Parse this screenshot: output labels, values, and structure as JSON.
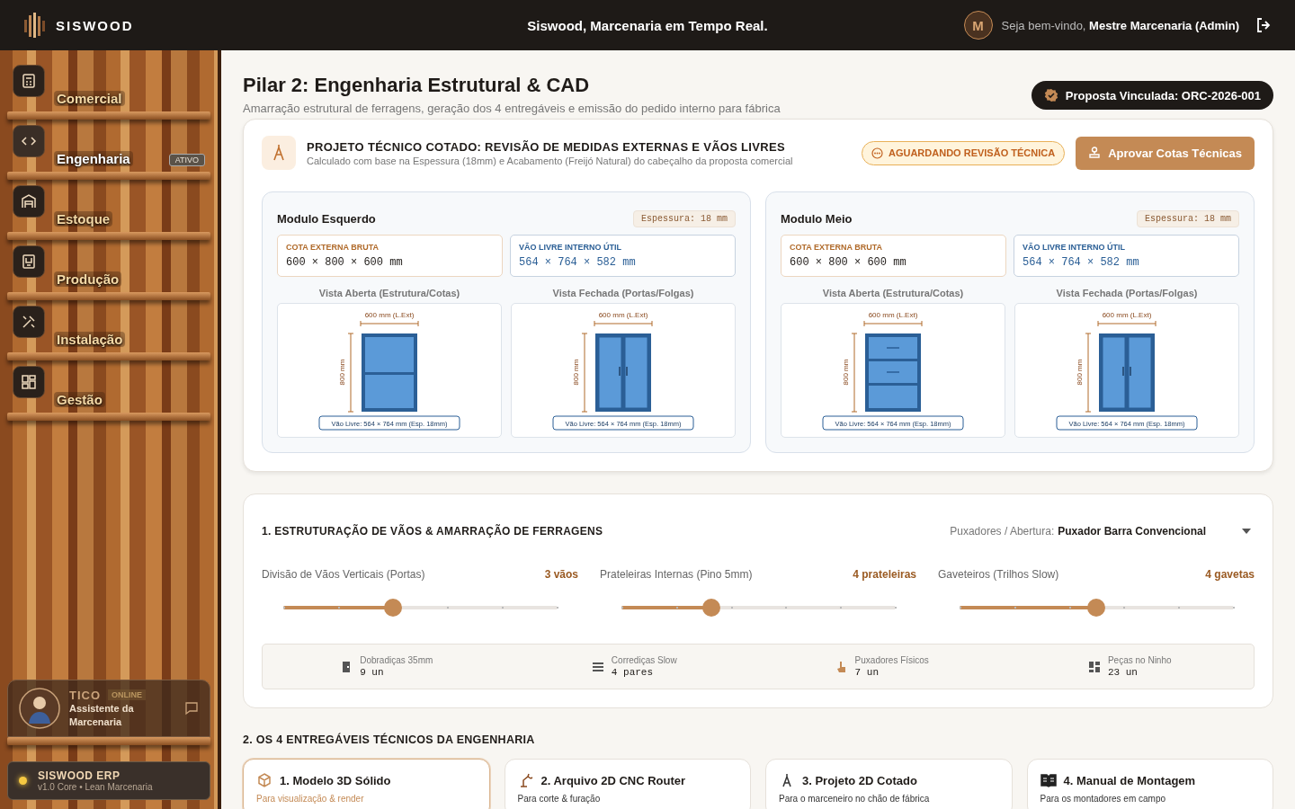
{
  "header": {
    "brand": "SISWOOD",
    "tagline": "Siswood, Marcenaria em Tempo Real.",
    "avatar": "M",
    "greeting": "Seja bem-vindo,",
    "user": "Mestre Marcenaria (Admin)"
  },
  "sidebar": {
    "items": [
      {
        "label": "Comercial",
        "kind": "calculator",
        "selected": false
      },
      {
        "label": "Engenharia",
        "kind": "code",
        "selected": true,
        "badge": "ATIVO"
      },
      {
        "label": "Estoque",
        "kind": "warehouse",
        "selected": false
      },
      {
        "label": "Produção",
        "kind": "factory",
        "selected": false
      },
      {
        "label": "Instalação",
        "kind": "tools",
        "selected": false
      },
      {
        "label": "Gestão",
        "kind": "dashboard",
        "selected": false
      }
    ],
    "assistant": {
      "name": "TICO",
      "status": "ONLINE",
      "role": "Assistente da Marcenaria"
    },
    "footer": {
      "name": "SISWOOD ERP",
      "version": "v1.0 Core • Lean Marcenaria"
    }
  },
  "page": {
    "title": "Pilar 2: Engenharia Estrutural & CAD",
    "subtitle": "Amarração estrutural de ferragens, geração dos 4 entregáveis e emissão do pedido interno para fábrica",
    "proposal": "Proposta Vinculada: ORC-2026-001"
  },
  "project": {
    "title": "PROJETO TÉCNICO COTADO: REVISÃO DE MEDIDAS EXTERNAS E VÃOS LIVRES",
    "subtitle": "Calculado com base na Espessura (18mm) e Acabamento (Freijó Natural) do cabeçalho da proposta comercial",
    "status": "AGUARDANDO REVISÃO TÉCNICA",
    "approve": "Aprovar Cotas Técnicas",
    "modules": [
      {
        "name": "Modulo Esquerdo",
        "thickness": "Espessura: 18 mm",
        "external_label": "COTA EXTERNA BRUTA",
        "external": "600 × 800 × 600 mm",
        "internal_label": "VÃO LIVRE INTERNO ÚTIL",
        "internal": "564 × 764 × 582 mm",
        "views": [
          {
            "title": "Vista Aberta (Estrutura/Cotas)",
            "kind": "shelves",
            "width_label": "600 mm (L.Ext)",
            "height_label": "800 mm",
            "gap_label": "Vão Livre: 564 × 764 mm (Esp. 18mm)"
          },
          {
            "title": "Vista Fechada (Portas/Folgas)",
            "kind": "doors",
            "width_label": "600 mm (L.Ext)",
            "height_label": "800 mm",
            "gap_label": "Vão Livre: 564 × 764 mm (Esp. 18mm)"
          }
        ]
      },
      {
        "name": "Modulo Meio",
        "thickness": "Espessura: 18 mm",
        "external_label": "COTA EXTERNA BRUTA",
        "external": "600 × 800 × 600 mm",
        "internal_label": "VÃO LIVRE INTERNO ÚTIL",
        "internal": "564 × 764 × 582 mm",
        "views": [
          {
            "title": "Vista Aberta (Estrutura/Cotas)",
            "kind": "drawers",
            "width_label": "600 mm (L.Ext)",
            "height_label": "800 mm",
            "gap_label": "Vão Livre: 564 × 764 mm (Esp. 18mm)"
          },
          {
            "title": "Vista Fechada (Portas/Folgas)",
            "kind": "doors",
            "width_label": "600 mm (L.Ext)",
            "height_label": "800 mm",
            "gap_label": "Vão Livre: 564 × 764 mm (Esp. 18mm)"
          }
        ]
      }
    ]
  },
  "structure": {
    "title": "1. ESTRUTURAÇÃO DE VÃOS & AMARRAÇÃO DE FERRAGENS",
    "handle_label": "Puxadores / Abertura:",
    "handle_value": "Puxador Barra Convencional",
    "sliders": [
      {
        "label": "Divisão de Vãos Verticais (Portas)",
        "reading": "3 vãos",
        "level": 0.4
      },
      {
        "label": "Prateleiras Internas (Pino 5mm)",
        "reading": "4 prateleiras",
        "level": 0.33
      },
      {
        "label": "Gaveteiros (Trilhos Slow)",
        "reading": "4 gavetas",
        "level": 0.5
      }
    ],
    "summary": [
      {
        "kind": "hinge",
        "label": "Dobradiças 35mm",
        "value": "9 un"
      },
      {
        "kind": "slide",
        "label": "Corrediças Slow",
        "value": "4 pares"
      },
      {
        "kind": "handle",
        "label": "Puxadores Físicos",
        "value": "7 un"
      },
      {
        "kind": "parts",
        "label": "Peças no Ninho",
        "value": "23 un"
      }
    ]
  },
  "deliverables": {
    "title": "2. OS 4 ENTREGÁVEIS TÉCNICOS DA ENGENHARIA",
    "items": [
      {
        "kind": "cube",
        "title": "1. Modelo 3D Sólido",
        "subtitle": "Para visualização & render",
        "selected": true
      },
      {
        "kind": "robot",
        "title": "2. Arquivo 2D CNC Router",
        "subtitle": "Para corte & furação",
        "selected": false
      },
      {
        "kind": "compass",
        "title": "3. Projeto 2D Cotado",
        "subtitle": "Para o marceneiro no chão de fábrica",
        "selected": false
      },
      {
        "kind": "book",
        "title": "4. Manual de Montagem",
        "subtitle": "Para os montadores em campo",
        "selected": false
      }
    ]
  }
}
